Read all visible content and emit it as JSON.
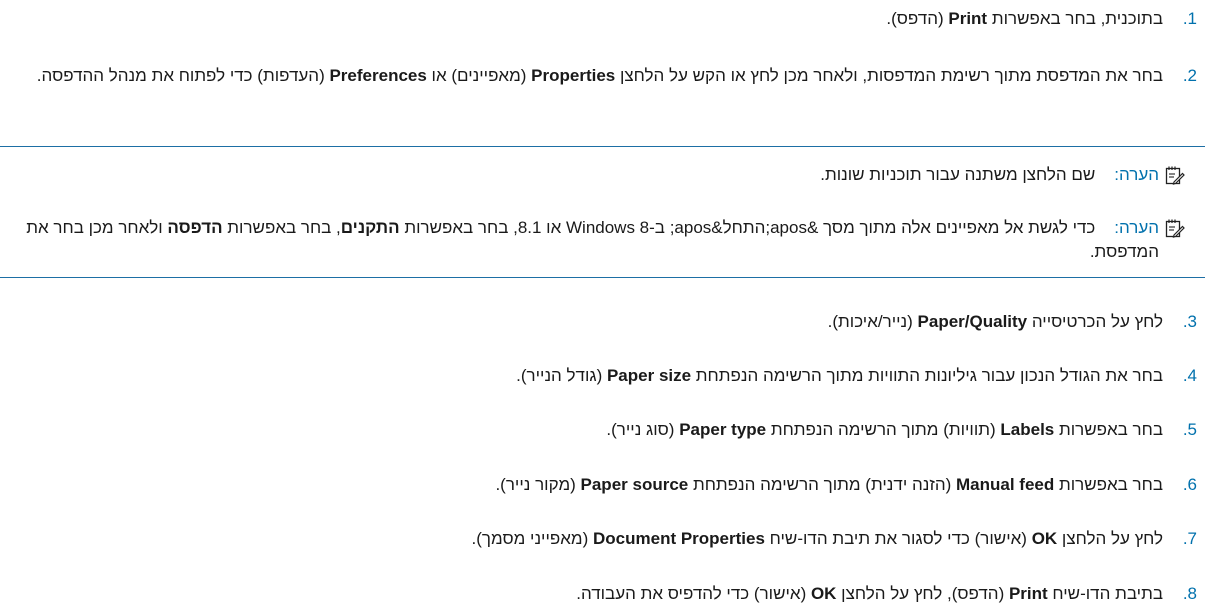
{
  "note_label": "הערה:",
  "steps": [
    {
      "num": ".1",
      "text": [
        "בתוכנית, בחר באפשרות ",
        {
          "b": "Print"
        },
        " (הדפס)."
      ]
    },
    {
      "num": ".2",
      "text": [
        "בחר את המדפסת מתוך רשימת המדפסות, ולאחר מכן לחץ או הקש על הלחצן ",
        {
          "b": "Properties"
        },
        " (מאפיינים) או ",
        {
          "b": "Preferences"
        },
        " (העדפות) כדי לפתוח את מנהל ההדפסה."
      ]
    },
    {
      "num": ".3",
      "text": [
        "לחץ על הכרטיסייה ",
        {
          "b": "Paper/Quality"
        },
        " (נייר/איכות)."
      ]
    },
    {
      "num": ".4",
      "text": [
        "בחר את הגודל הנכון עבור גיליונות התוויות מתוך הרשימה הנפתחת ",
        {
          "b": "Paper size"
        },
        " (גודל הנייר)."
      ]
    },
    {
      "num": ".5",
      "text": [
        "בחר באפשרות ",
        {
          "b": "Labels"
        },
        " (תוויות) מתוך הרשימה הנפתחת ",
        {
          "b": "Paper type"
        },
        " (סוג נייר)."
      ]
    },
    {
      "num": ".6",
      "text": [
        "בחר באפשרות ",
        {
          "b": "Manual feed"
        },
        " (הזנה ידנית) מתוך הרשימה הנפתחת ",
        {
          "b": "Paper source"
        },
        " (מקור נייר)."
      ]
    },
    {
      "num": ".7",
      "text": [
        "לחץ על הלחצן ",
        {
          "b": "OK"
        },
        " (אישור) כדי לסגור את תיבת הדו-שיח ",
        {
          "b": "Document Properties"
        },
        " (מאפייני מסמך)."
      ]
    },
    {
      "num": ".8",
      "text": [
        "בתיבת הדו-שיח ",
        {
          "b": "Print"
        },
        " (הדפס), לחץ על הלחצן ",
        {
          "b": "OK"
        },
        " (אישור) כדי להדפיס את העבודה."
      ]
    }
  ],
  "notes": [
    {
      "text": [
        "שם הלחצן משתנה עבור תוכניות שונות."
      ]
    },
    {
      "text": [
        "כדי לגשת אל מאפיינים אלה מתוך מסך &apos;התחל&apos; ב-Windows 8 או 8.1, בחר באפשרות ",
        {
          "b": "התקנים"
        },
        ", בחר באפשרות ",
        {
          "b": "הדפסה"
        },
        " ולאחר מכן בחר את המדפסת."
      ]
    }
  ],
  "colors": {
    "accent": "#0171ad",
    "rule": "#1d6fa5",
    "text": "#1a1a1a"
  },
  "icons": {
    "note": "note-pencil-icon"
  }
}
